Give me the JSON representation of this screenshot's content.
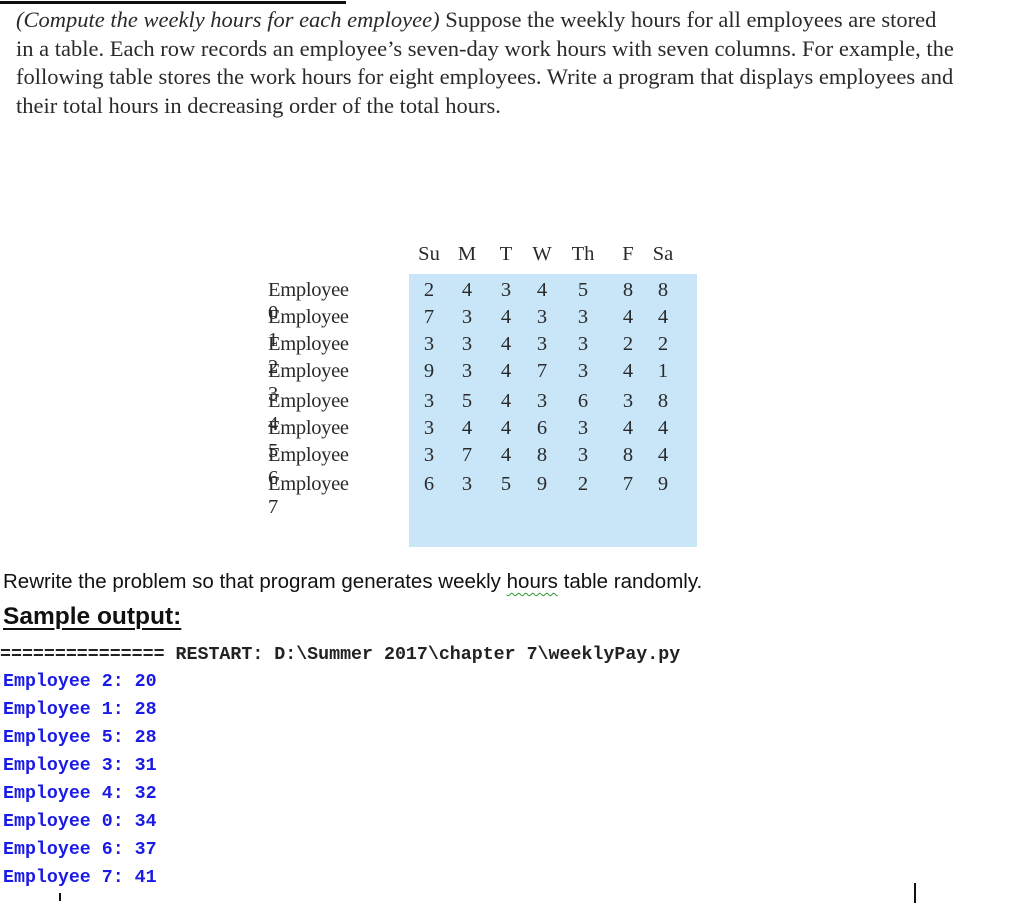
{
  "problem": {
    "title_italic": "(Compute the weekly hours for each employee)",
    "body": " Suppose the weekly hours for all employees are stored in a table. Each row records an employee’s seven-day work hours with seven columns. For example, the following table stores the work hours for eight employees. Write a program that displays employees and their total hours in decreasing order of the total hours."
  },
  "hours_table": {
    "columns": [
      "Su",
      "M",
      "T",
      "W",
      "Th",
      "F",
      "Sa"
    ],
    "rows": [
      {
        "label": "Employee 0",
        "values": [
          "2",
          "4",
          "3",
          "4",
          "5",
          "8",
          "8"
        ]
      },
      {
        "label": "Employee 1",
        "values": [
          "7",
          "3",
          "4",
          "3",
          "3",
          "4",
          "4"
        ]
      },
      {
        "label": "Employee 2",
        "values": [
          "3",
          "3",
          "4",
          "3",
          "3",
          "2",
          "2"
        ]
      },
      {
        "label": "Employee 3",
        "values": [
          "9",
          "3",
          "4",
          "7",
          "3",
          "4",
          "1"
        ]
      },
      {
        "label": "Employee 4",
        "values": [
          "3",
          "5",
          "4",
          "3",
          "6",
          "3",
          "8"
        ]
      },
      {
        "label": "Employee 5",
        "values": [
          "3",
          "4",
          "4",
          "6",
          "3",
          "4",
          "4"
        ]
      },
      {
        "label": "Employee 6",
        "values": [
          "3",
          "7",
          "4",
          "8",
          "3",
          "8",
          "4"
        ]
      },
      {
        "label": "Employee 7",
        "values": [
          "6",
          "3",
          "5",
          "9",
          "2",
          "7",
          "9"
        ]
      }
    ],
    "background_color": "#c8e6f8"
  },
  "rewrite": {
    "before": "Rewrite the problem so that program generates weekly ",
    "flagged_word": "hours",
    "after": " table randomly."
  },
  "sample_heading": "Sample output:",
  "console": {
    "restart_line": "=============== RESTART: D:\\Summer 2017\\chapter 7\\weeklyPay.py",
    "output_color": "#1a1ae6",
    "lines": [
      "Employee 2: 20",
      "Employee 1: 28",
      "Employee 5: 28",
      "Employee 3: 31",
      "Employee 4: 32",
      "Employee 0: 34",
      "Employee 6: 37",
      "Employee 7: 41"
    ]
  }
}
